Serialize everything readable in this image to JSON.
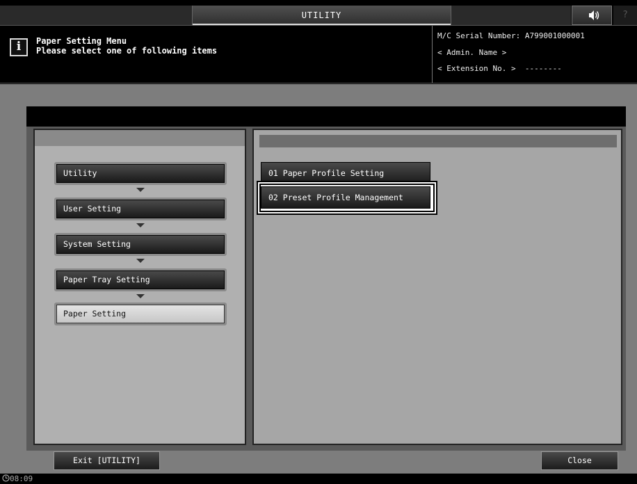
{
  "header": {
    "title": "UTILITY",
    "speaker_icon": "speaker-icon",
    "help_label": "?"
  },
  "message": {
    "icon_label": "i",
    "title": "Paper Setting Menu",
    "subtitle": "Please select one of following items"
  },
  "machine_info": {
    "serial": "M/C Serial Number: A799001000001",
    "admin": "< Admin. Name >",
    "extension": "< Extension No. >  --------"
  },
  "breadcrumb": {
    "items": [
      {
        "label": "Utility"
      },
      {
        "label": "User Setting"
      },
      {
        "label": "System Setting"
      },
      {
        "label": "Paper Tray Setting"
      },
      {
        "label": "Paper Setting"
      }
    ]
  },
  "options": [
    {
      "label": "01 Paper Profile Setting"
    },
    {
      "label": "02 Preset Profile Management"
    }
  ],
  "footer": {
    "exit_label": "Exit [UTILITY]",
    "close_label": "Close",
    "time": "08:09"
  }
}
